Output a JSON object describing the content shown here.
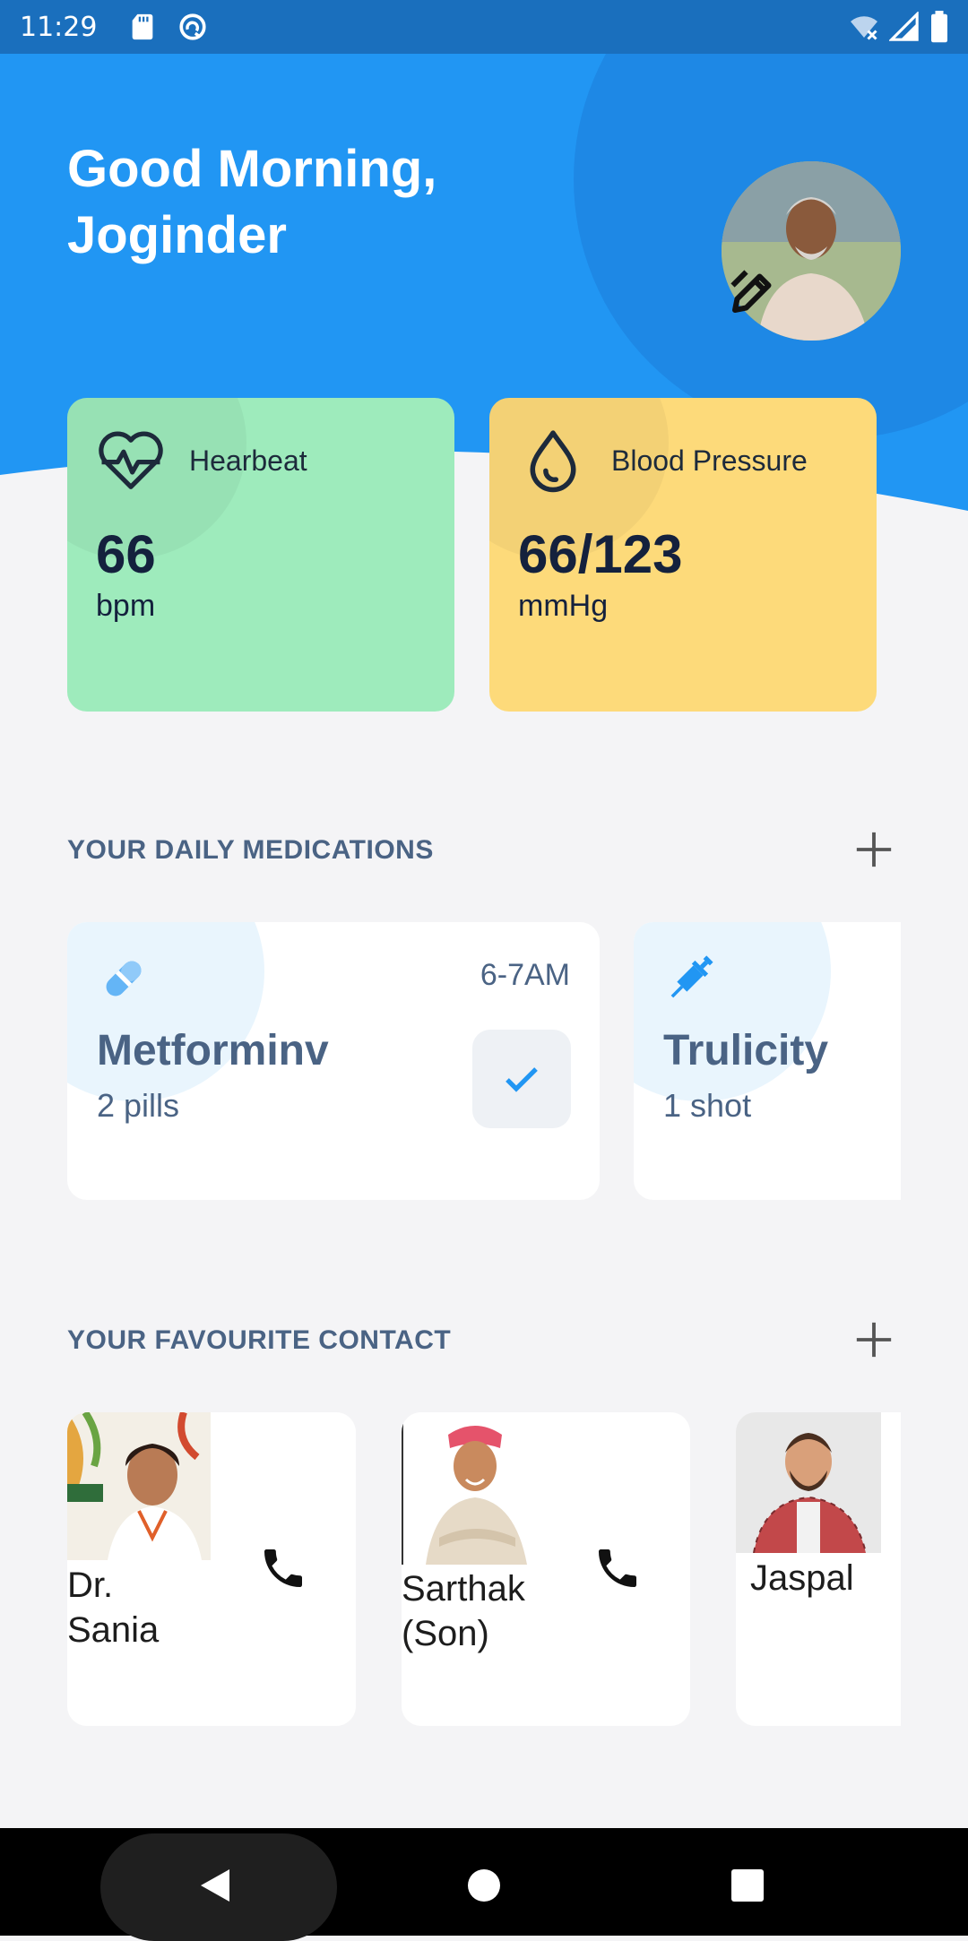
{
  "status_bar": {
    "time": "11:29",
    "icons": [
      "sd-card-icon",
      "sync-icon",
      "wifi-off-icon",
      "signal-icon",
      "battery-icon"
    ]
  },
  "header": {
    "greeting_line1": "Good Morning,",
    "greeting_line2": "Joginder",
    "colors": {
      "background": "#2196f3",
      "circle": "#1e88e5"
    }
  },
  "vitals": [
    {
      "label": "Hearbeat",
      "value": "66",
      "unit": "bpm",
      "icon": "heartbeat-icon",
      "color": "#9eebbc"
    },
    {
      "label": "Blood Pressure",
      "value": "66/123",
      "unit": "mmHg",
      "icon": "blood-drop-icon",
      "color": "#fdda7a"
    }
  ],
  "medications": {
    "title": "YOUR DAILY MEDICATIONS",
    "items": [
      {
        "name": "Metforminv",
        "dose": "2 pills",
        "time": "6-7AM",
        "icon": "pill-icon",
        "taken": true
      },
      {
        "name": "Trulicity",
        "dose": "1 shot",
        "icon": "syringe-icon"
      }
    ]
  },
  "contacts": {
    "title": "YOUR FAVOURITE CONTACT",
    "items": [
      {
        "name_line1": "Dr.",
        "name_line2": "Sania"
      },
      {
        "name_line1": "Sarthak",
        "name_line2": "(Son)"
      },
      {
        "name_line1": "Jaspal",
        "name_line2": ""
      }
    ]
  },
  "accent_color": "#2196f3"
}
